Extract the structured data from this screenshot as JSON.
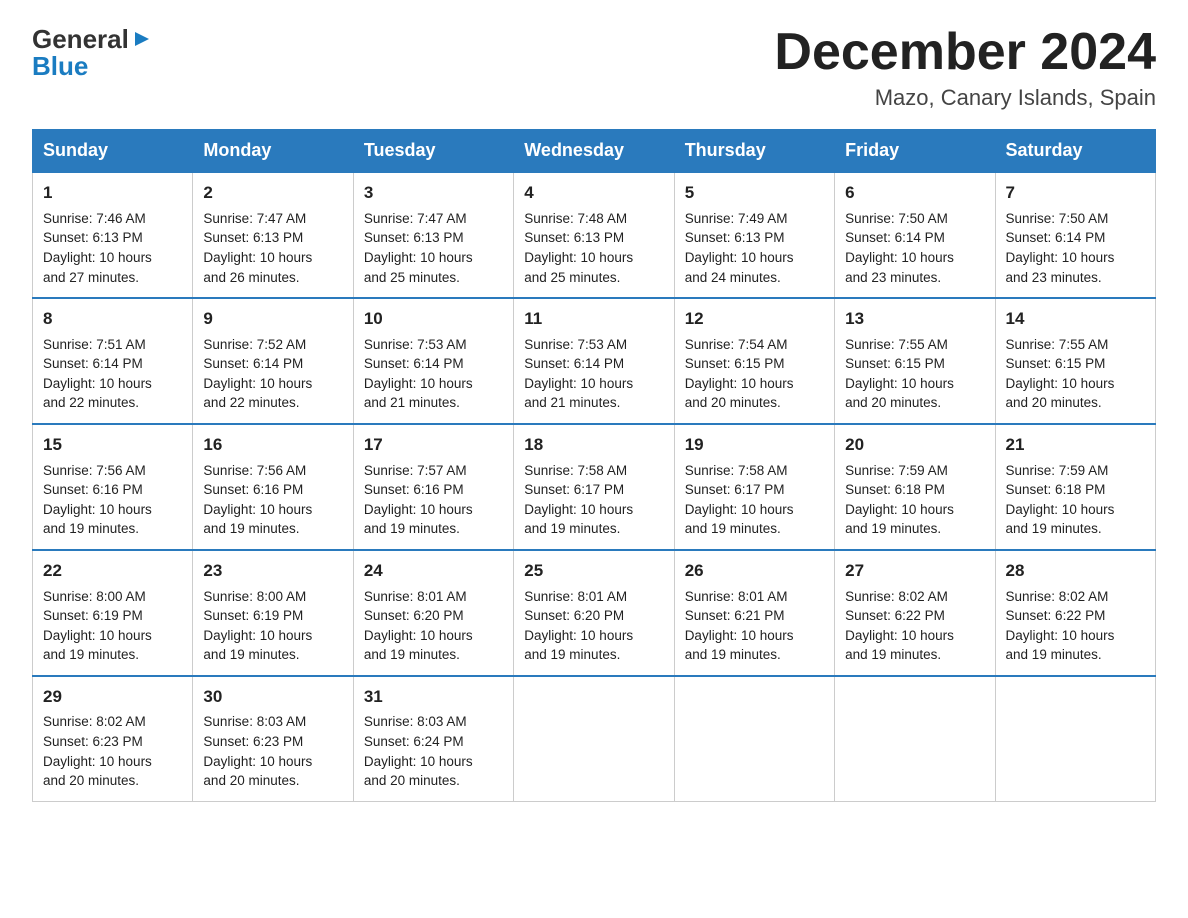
{
  "logo": {
    "line1": "General",
    "arrow": "▶",
    "line2": "Blue"
  },
  "title": "December 2024",
  "location": "Mazo, Canary Islands, Spain",
  "headers": [
    "Sunday",
    "Monday",
    "Tuesday",
    "Wednesday",
    "Thursday",
    "Friday",
    "Saturday"
  ],
  "weeks": [
    [
      {
        "day": "1",
        "lines": [
          "Sunrise: 7:46 AM",
          "Sunset: 6:13 PM",
          "Daylight: 10 hours",
          "and 27 minutes."
        ]
      },
      {
        "day": "2",
        "lines": [
          "Sunrise: 7:47 AM",
          "Sunset: 6:13 PM",
          "Daylight: 10 hours",
          "and 26 minutes."
        ]
      },
      {
        "day": "3",
        "lines": [
          "Sunrise: 7:47 AM",
          "Sunset: 6:13 PM",
          "Daylight: 10 hours",
          "and 25 minutes."
        ]
      },
      {
        "day": "4",
        "lines": [
          "Sunrise: 7:48 AM",
          "Sunset: 6:13 PM",
          "Daylight: 10 hours",
          "and 25 minutes."
        ]
      },
      {
        "day": "5",
        "lines": [
          "Sunrise: 7:49 AM",
          "Sunset: 6:13 PM",
          "Daylight: 10 hours",
          "and 24 minutes."
        ]
      },
      {
        "day": "6",
        "lines": [
          "Sunrise: 7:50 AM",
          "Sunset: 6:14 PM",
          "Daylight: 10 hours",
          "and 23 minutes."
        ]
      },
      {
        "day": "7",
        "lines": [
          "Sunrise: 7:50 AM",
          "Sunset: 6:14 PM",
          "Daylight: 10 hours",
          "and 23 minutes."
        ]
      }
    ],
    [
      {
        "day": "8",
        "lines": [
          "Sunrise: 7:51 AM",
          "Sunset: 6:14 PM",
          "Daylight: 10 hours",
          "and 22 minutes."
        ]
      },
      {
        "day": "9",
        "lines": [
          "Sunrise: 7:52 AM",
          "Sunset: 6:14 PM",
          "Daylight: 10 hours",
          "and 22 minutes."
        ]
      },
      {
        "day": "10",
        "lines": [
          "Sunrise: 7:53 AM",
          "Sunset: 6:14 PM",
          "Daylight: 10 hours",
          "and 21 minutes."
        ]
      },
      {
        "day": "11",
        "lines": [
          "Sunrise: 7:53 AM",
          "Sunset: 6:14 PM",
          "Daylight: 10 hours",
          "and 21 minutes."
        ]
      },
      {
        "day": "12",
        "lines": [
          "Sunrise: 7:54 AM",
          "Sunset: 6:15 PM",
          "Daylight: 10 hours",
          "and 20 minutes."
        ]
      },
      {
        "day": "13",
        "lines": [
          "Sunrise: 7:55 AM",
          "Sunset: 6:15 PM",
          "Daylight: 10 hours",
          "and 20 minutes."
        ]
      },
      {
        "day": "14",
        "lines": [
          "Sunrise: 7:55 AM",
          "Sunset: 6:15 PM",
          "Daylight: 10 hours",
          "and 20 minutes."
        ]
      }
    ],
    [
      {
        "day": "15",
        "lines": [
          "Sunrise: 7:56 AM",
          "Sunset: 6:16 PM",
          "Daylight: 10 hours",
          "and 19 minutes."
        ]
      },
      {
        "day": "16",
        "lines": [
          "Sunrise: 7:56 AM",
          "Sunset: 6:16 PM",
          "Daylight: 10 hours",
          "and 19 minutes."
        ]
      },
      {
        "day": "17",
        "lines": [
          "Sunrise: 7:57 AM",
          "Sunset: 6:16 PM",
          "Daylight: 10 hours",
          "and 19 minutes."
        ]
      },
      {
        "day": "18",
        "lines": [
          "Sunrise: 7:58 AM",
          "Sunset: 6:17 PM",
          "Daylight: 10 hours",
          "and 19 minutes."
        ]
      },
      {
        "day": "19",
        "lines": [
          "Sunrise: 7:58 AM",
          "Sunset: 6:17 PM",
          "Daylight: 10 hours",
          "and 19 minutes."
        ]
      },
      {
        "day": "20",
        "lines": [
          "Sunrise: 7:59 AM",
          "Sunset: 6:18 PM",
          "Daylight: 10 hours",
          "and 19 minutes."
        ]
      },
      {
        "day": "21",
        "lines": [
          "Sunrise: 7:59 AM",
          "Sunset: 6:18 PM",
          "Daylight: 10 hours",
          "and 19 minutes."
        ]
      }
    ],
    [
      {
        "day": "22",
        "lines": [
          "Sunrise: 8:00 AM",
          "Sunset: 6:19 PM",
          "Daylight: 10 hours",
          "and 19 minutes."
        ]
      },
      {
        "day": "23",
        "lines": [
          "Sunrise: 8:00 AM",
          "Sunset: 6:19 PM",
          "Daylight: 10 hours",
          "and 19 minutes."
        ]
      },
      {
        "day": "24",
        "lines": [
          "Sunrise: 8:01 AM",
          "Sunset: 6:20 PM",
          "Daylight: 10 hours",
          "and 19 minutes."
        ]
      },
      {
        "day": "25",
        "lines": [
          "Sunrise: 8:01 AM",
          "Sunset: 6:20 PM",
          "Daylight: 10 hours",
          "and 19 minutes."
        ]
      },
      {
        "day": "26",
        "lines": [
          "Sunrise: 8:01 AM",
          "Sunset: 6:21 PM",
          "Daylight: 10 hours",
          "and 19 minutes."
        ]
      },
      {
        "day": "27",
        "lines": [
          "Sunrise: 8:02 AM",
          "Sunset: 6:22 PM",
          "Daylight: 10 hours",
          "and 19 minutes."
        ]
      },
      {
        "day": "28",
        "lines": [
          "Sunrise: 8:02 AM",
          "Sunset: 6:22 PM",
          "Daylight: 10 hours",
          "and 19 minutes."
        ]
      }
    ],
    [
      {
        "day": "29",
        "lines": [
          "Sunrise: 8:02 AM",
          "Sunset: 6:23 PM",
          "Daylight: 10 hours",
          "and 20 minutes."
        ]
      },
      {
        "day": "30",
        "lines": [
          "Sunrise: 8:03 AM",
          "Sunset: 6:23 PM",
          "Daylight: 10 hours",
          "and 20 minutes."
        ]
      },
      {
        "day": "31",
        "lines": [
          "Sunrise: 8:03 AM",
          "Sunset: 6:24 PM",
          "Daylight: 10 hours",
          "and 20 minutes."
        ]
      },
      null,
      null,
      null,
      null
    ]
  ]
}
